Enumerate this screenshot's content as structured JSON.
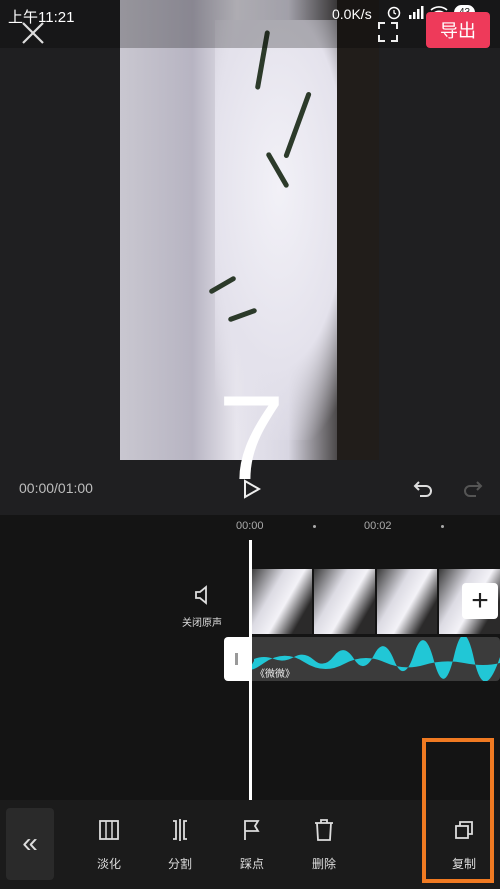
{
  "status_bar": {
    "time": "上午11:21",
    "speed": "0.0K/s",
    "battery": "43"
  },
  "header": {
    "export_label": "导出"
  },
  "preview": {
    "overlay_number": "7",
    "timecode": "00:00/01:00"
  },
  "timeline": {
    "ruler": [
      "00:00",
      "00:02"
    ],
    "mute_label": "关闭原声",
    "audio_name": "《微微》",
    "add_label": "+"
  },
  "toolbar": {
    "back_label": "«",
    "items": [
      {
        "label": "淡化",
        "icon": "fade-icon"
      },
      {
        "label": "分割",
        "icon": "split-icon"
      },
      {
        "label": "踩点",
        "icon": "flag-icon"
      },
      {
        "label": "删除",
        "icon": "delete-icon"
      },
      {
        "label": "复制",
        "icon": "copy-icon"
      }
    ]
  },
  "colors": {
    "accent": "#ee3a5a",
    "highlight": "#f07a22",
    "audio_wave": "#21c7d6"
  }
}
